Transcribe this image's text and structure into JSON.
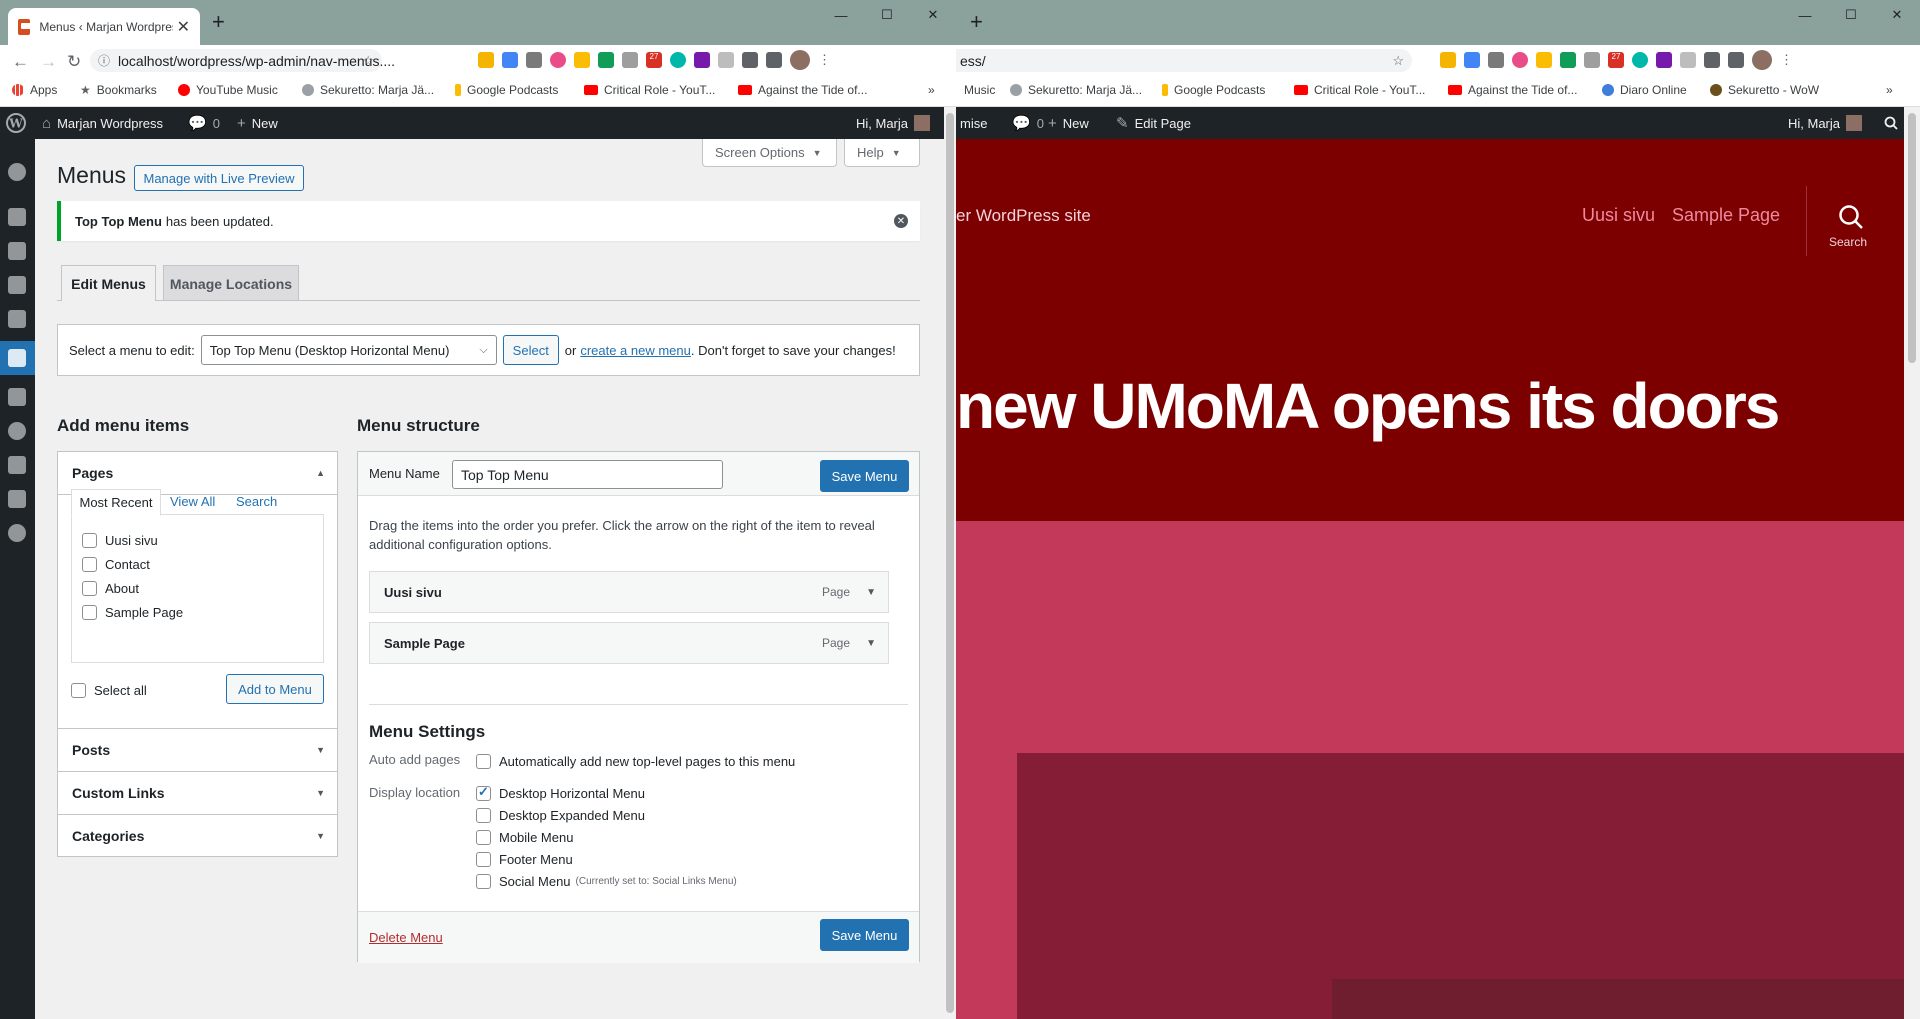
{
  "left_browser": {
    "tab_title": "Menus ‹ Marjan Wordpress — W",
    "url": "localhost/wordpress/wp-admin/nav-menus....",
    "bookmarks": [
      "Apps",
      "Bookmarks",
      "YouTube Music",
      "Sekuretto: Marja Jä...",
      "Google Podcasts",
      "Critical Role - YouT...",
      "Against the Tide of..."
    ],
    "extension_badge": "27",
    "more": "»"
  },
  "right_browser": {
    "url": "ess/",
    "bookmarks": [
      "Music",
      "Sekuretto: Marja Jä...",
      "Google Podcasts",
      "Critical Role - YouT...",
      "Against the Tide of...",
      "Diaro Online",
      "Sekuretto - WoW"
    ],
    "extension_badge": "27",
    "more": "»"
  },
  "admin_bar_left": {
    "site_name": "Marjan Wordpress",
    "comments": "0",
    "new": "New",
    "greeting": "Hi, Marja"
  },
  "admin_bar_right": {
    "customise": "mise",
    "comments": "0",
    "new": "New",
    "edit_page": "Edit Page",
    "greeting": "Hi, Marja"
  },
  "wp": {
    "screen_options": "Screen Options",
    "help": "Help",
    "title": "Menus",
    "live_preview": "Manage with Live Preview",
    "notice_bold": "Top Top Menu",
    "notice_rest": "has been updated.",
    "tabs": [
      "Edit Menus",
      "Manage Locations"
    ],
    "select_label": "Select a menu to edit:",
    "selected_menu": "Top Top Menu (Desktop Horizontal Menu)",
    "select_button": "Select",
    "or": "or",
    "create_link": "create a new menu",
    "dont_forget": ". Don't forget to save your changes!",
    "add_items_title": "Add menu items",
    "pages_title": "Pages",
    "page_tabs": [
      "Most Recent",
      "View All",
      "Search"
    ],
    "pages": [
      "Uusi sivu",
      "Contact",
      "About",
      "Sample Page"
    ],
    "select_all": "Select all",
    "add_to_menu": "Add to Menu",
    "accordions": [
      "Posts",
      "Custom Links",
      "Categories"
    ],
    "structure_title": "Menu structure",
    "menu_name_label": "Menu Name",
    "menu_name_value": "Top Top Menu",
    "save_menu": "Save Menu",
    "instructions": "Drag the items into the order you prefer. Click the arrow on the right of the item to reveal additional configuration options.",
    "menu_items": [
      {
        "label": "Uusi sivu",
        "type": "Page"
      },
      {
        "label": "Sample Page",
        "type": "Page"
      }
    ],
    "settings_title": "Menu Settings",
    "auto_add_label": "Auto add pages",
    "auto_add_text": "Automatically add new top-level pages to this menu",
    "display_location_label": "Display location",
    "locations": [
      {
        "label": "Desktop Horizontal Menu",
        "checked": true,
        "note": ""
      },
      {
        "label": "Desktop Expanded Menu",
        "checked": false,
        "note": ""
      },
      {
        "label": "Mobile Menu",
        "checked": false,
        "note": ""
      },
      {
        "label": "Footer Menu",
        "checked": false,
        "note": ""
      },
      {
        "label": "Social Menu",
        "checked": false,
        "note": "(Currently set to: Social Links Menu)"
      }
    ],
    "delete_menu": "Delete Menu"
  },
  "site": {
    "tagline": "er WordPress site",
    "nav": [
      "Uusi sivu",
      "Sample Page"
    ],
    "search_label": "Search",
    "headline": "new UMoMA opens its doors",
    "colors": {
      "hero": "#7c0000",
      "body": "#c2395a",
      "block": "#851d36",
      "nav": "#ef8a9e"
    }
  }
}
